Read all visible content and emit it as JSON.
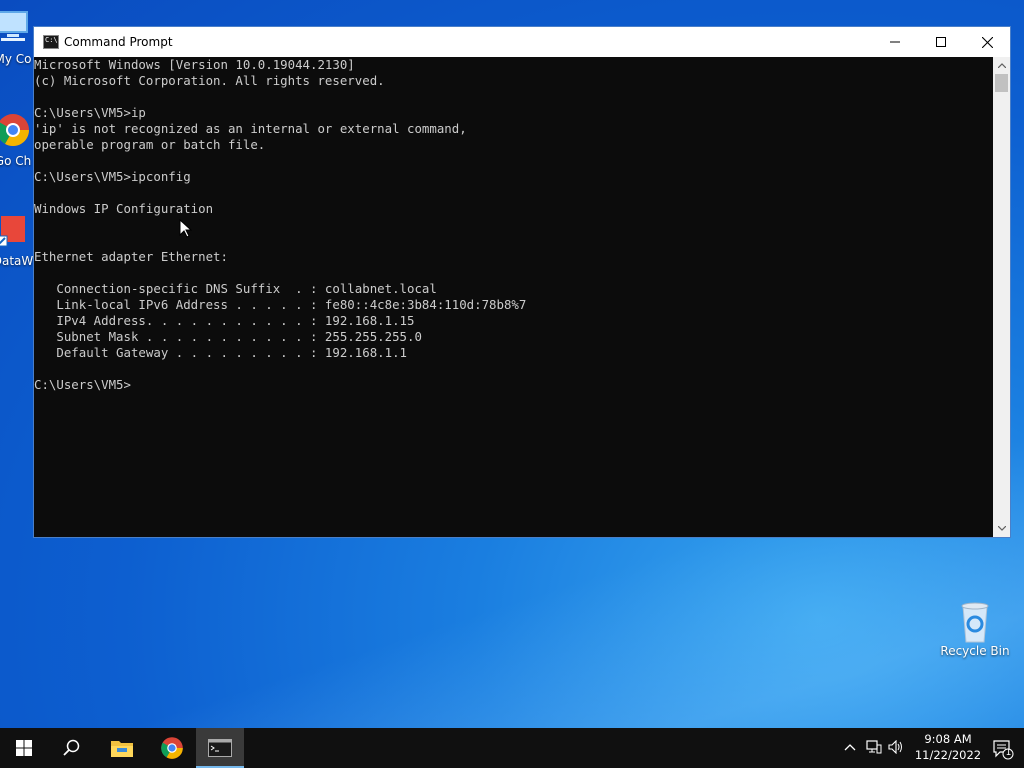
{
  "desktop": {
    "icons": [
      {
        "label": "My Co"
      },
      {
        "label": "Go Ch"
      },
      {
        "label": "DataW"
      },
      {
        "label": "Recycle Bin"
      }
    ]
  },
  "window": {
    "title": "Command Prompt",
    "buttons": {
      "minimize": "—",
      "maximize": "☐",
      "close": "✕"
    }
  },
  "console": {
    "lines": [
      "Microsoft Windows [Version 10.0.19044.2130]",
      "(c) Microsoft Corporation. All rights reserved.",
      "",
      "C:\\Users\\VM5>ip",
      "'ip' is not recognized as an internal or external command,",
      "operable program or batch file.",
      "",
      "C:\\Users\\VM5>ipconfig",
      "",
      "Windows IP Configuration",
      "",
      "",
      "Ethernet adapter Ethernet:",
      "",
      "   Connection-specific DNS Suffix  . : collabnet.local",
      "   Link-local IPv6 Address . . . . . : fe80::4c8e:3b84:110d:78b8%7",
      "   IPv4 Address. . . . . . . . . . . : 192.168.1.15",
      "   Subnet Mask . . . . . . . . . . . : 255.255.255.0",
      "   Default Gateway . . . . . . . . . : 192.168.1.1",
      "",
      "C:\\Users\\VM5>"
    ]
  },
  "taskbar": {
    "clock_time": "9:08 AM",
    "clock_date": "11/22/2022",
    "notification_count": "1"
  },
  "colors": {
    "console_bg": "#0c0c0c",
    "console_fg": "#cccccc",
    "taskbar_bg": "#101010",
    "accent": "#76b9ed"
  }
}
